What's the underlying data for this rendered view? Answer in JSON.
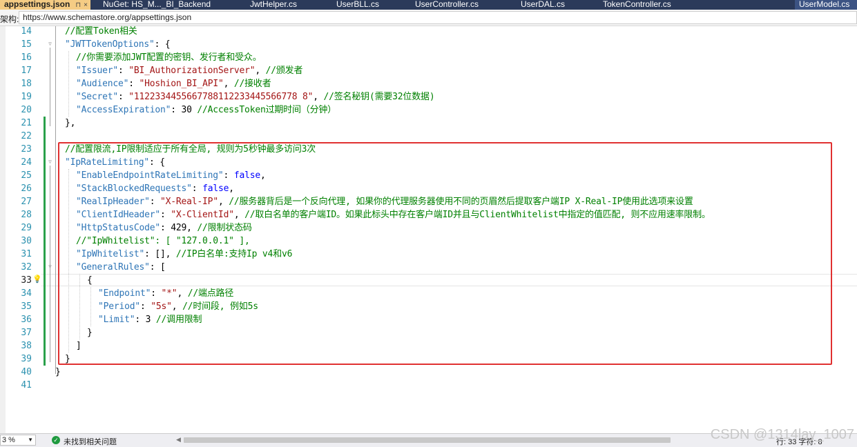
{
  "tabs": [
    {
      "label": "appsettings.json",
      "active": true
    },
    {
      "label": "NuGet: HS_M..._BI_Backend"
    },
    {
      "label": "JwtHelper.cs"
    },
    {
      "label": "UserBLL.cs"
    },
    {
      "label": "UserController.cs"
    },
    {
      "label": "UserDAL.cs"
    },
    {
      "label": "TokenController.cs"
    },
    {
      "label": "UserModel.cs"
    }
  ],
  "tab_icons": {
    "pin": "⊓",
    "close": "×"
  },
  "schema": {
    "label": "架构:",
    "url": "https://www.schemastore.org/appsettings.json"
  },
  "code_lines": [
    {
      "n": "14",
      "tokens": [
        [
          "c",
          "//配置Token相关"
        ]
      ],
      "indent": 0
    },
    {
      "n": "15",
      "tokens": [
        [
          "k",
          "\"JWTTokenOptions\""
        ],
        [
          "p",
          ": {"
        ]
      ],
      "indent": 0
    },
    {
      "n": "16",
      "tokens": [
        [
          "c",
          "//你需要添加JWT配置的密钥、发行者和受众。"
        ]
      ],
      "indent": 1
    },
    {
      "n": "17",
      "tokens": [
        [
          "k",
          "\"Issuer\""
        ],
        [
          "p",
          ": "
        ],
        [
          "s",
          "\"BI_AuthorizationServer\""
        ],
        [
          "p",
          ", "
        ],
        [
          "c",
          "//颁发者"
        ]
      ],
      "indent": 1
    },
    {
      "n": "18",
      "tokens": [
        [
          "k",
          "\"Audience\""
        ],
        [
          "p",
          ": "
        ],
        [
          "s",
          "\"Hoshion_BI_API\""
        ],
        [
          "p",
          ", "
        ],
        [
          "c",
          "//接收者"
        ]
      ],
      "indent": 1
    },
    {
      "n": "19",
      "tokens": [
        [
          "k",
          "\"Secret\""
        ],
        [
          "p",
          ": "
        ],
        [
          "s",
          "\"1122334455667788112233445566778 8\""
        ],
        [
          "p",
          ", "
        ],
        [
          "c",
          "//签名秘钥(需要32位数据)"
        ]
      ],
      "indent": 1
    },
    {
      "n": "20",
      "tokens": [
        [
          "k",
          "\"AccessExpiration\""
        ],
        [
          "p",
          ": 30 "
        ],
        [
          "c",
          "//AccessToken过期时间（分钟）"
        ]
      ],
      "indent": 1
    },
    {
      "n": "21",
      "tokens": [
        [
          "p",
          "},"
        ]
      ],
      "indent": 0
    },
    {
      "n": "22",
      "tokens": [],
      "indent": 0
    },
    {
      "n": "23",
      "tokens": [
        [
          "c",
          "//配置限流,IP限制适应于所有全局, 规则为5秒钟最多访问3次"
        ]
      ],
      "indent": 0
    },
    {
      "n": "24",
      "tokens": [
        [
          "k",
          "\"IpRateLimiting\""
        ],
        [
          "p",
          ": {"
        ]
      ],
      "indent": 0
    },
    {
      "n": "25",
      "tokens": [
        [
          "k",
          "\"EnableEndpointRateLimiting\""
        ],
        [
          "p",
          ": "
        ],
        [
          "w",
          "false"
        ],
        [
          "p",
          ","
        ]
      ],
      "indent": 1
    },
    {
      "n": "26",
      "tokens": [
        [
          "k",
          "\"StackBlockedRequests\""
        ],
        [
          "p",
          ": "
        ],
        [
          "w",
          "false"
        ],
        [
          "p",
          ","
        ]
      ],
      "indent": 1
    },
    {
      "n": "27",
      "tokens": [
        [
          "k",
          "\"RealIpHeader\""
        ],
        [
          "p",
          ": "
        ],
        [
          "s",
          "\"X-Real-IP\""
        ],
        [
          "p",
          ", "
        ],
        [
          "c",
          "//服务器背后是一个反向代理, 如果你的代理服务器使用不同的页眉然后提取客户端IP X-Real-IP使用此选项来设置"
        ]
      ],
      "indent": 1
    },
    {
      "n": "28",
      "tokens": [
        [
          "k",
          "\"ClientIdHeader\""
        ],
        [
          "p",
          ": "
        ],
        [
          "s",
          "\"X-ClientId\""
        ],
        [
          "p",
          ", "
        ],
        [
          "c",
          "//取白名单的客户端ID。如果此标头中存在客户端ID并且与ClientWhitelist中指定的值匹配, 则不应用速率限制。"
        ]
      ],
      "indent": 1
    },
    {
      "n": "29",
      "tokens": [
        [
          "k",
          "\"HttpStatusCode\""
        ],
        [
          "p",
          ": 429, "
        ],
        [
          "c",
          "//限制状态码"
        ]
      ],
      "indent": 1
    },
    {
      "n": "30",
      "tokens": [
        [
          "c",
          "//\"IpWhitelist\": [ \"127.0.0.1\" ],"
        ]
      ],
      "indent": 1
    },
    {
      "n": "31",
      "tokens": [
        [
          "k",
          "\"IpWhitelist\""
        ],
        [
          "p",
          ": [], "
        ],
        [
          "c",
          "//IP白名单:支持Ip v4和v6"
        ]
      ],
      "indent": 1
    },
    {
      "n": "32",
      "tokens": [
        [
          "k",
          "\"GeneralRules\""
        ],
        [
          "p",
          ": ["
        ]
      ],
      "indent": 1
    },
    {
      "n": "33",
      "tokens": [
        [
          "p",
          "{"
        ]
      ],
      "indent": 2,
      "current": true
    },
    {
      "n": "34",
      "tokens": [
        [
          "k",
          "\"Endpoint\""
        ],
        [
          "p",
          ": "
        ],
        [
          "s",
          "\"*\""
        ],
        [
          "p",
          ", "
        ],
        [
          "c",
          "//端点路径"
        ]
      ],
      "indent": 3
    },
    {
      "n": "35",
      "tokens": [
        [
          "k",
          "\"Period\""
        ],
        [
          "p",
          ": "
        ],
        [
          "s",
          "\"5s\""
        ],
        [
          "p",
          ", "
        ],
        [
          "c",
          "//时间段, 例如5s"
        ]
      ],
      "indent": 3
    },
    {
      "n": "36",
      "tokens": [
        [
          "k",
          "\"Limit\""
        ],
        [
          "p",
          ": 3 "
        ],
        [
          "c",
          "//调用限制"
        ]
      ],
      "indent": 3
    },
    {
      "n": "37",
      "tokens": [
        [
          "p",
          "}"
        ]
      ],
      "indent": 2
    },
    {
      "n": "38",
      "tokens": [
        [
          "p",
          "]"
        ]
      ],
      "indent": 1
    },
    {
      "n": "39",
      "tokens": [
        [
          "p",
          "}"
        ]
      ],
      "indent": 0
    },
    {
      "n": "40",
      "tokens": [
        [
          "p",
          "}"
        ]
      ],
      "indent": -1
    },
    {
      "n": "41",
      "tokens": [],
      "indent": -1
    }
  ],
  "status": {
    "zoom": "3 %",
    "issues": "未找到相关问题",
    "cursor": "行: 33    字符: 8"
  },
  "watermark": "CSDN @1314lay_1007",
  "colors": {
    "comment": "#008000",
    "key": "#2e75b6",
    "string": "#a31515",
    "keyword": "#0000ff",
    "highlight": "#e03030",
    "active_tab": "#f5cc84"
  }
}
